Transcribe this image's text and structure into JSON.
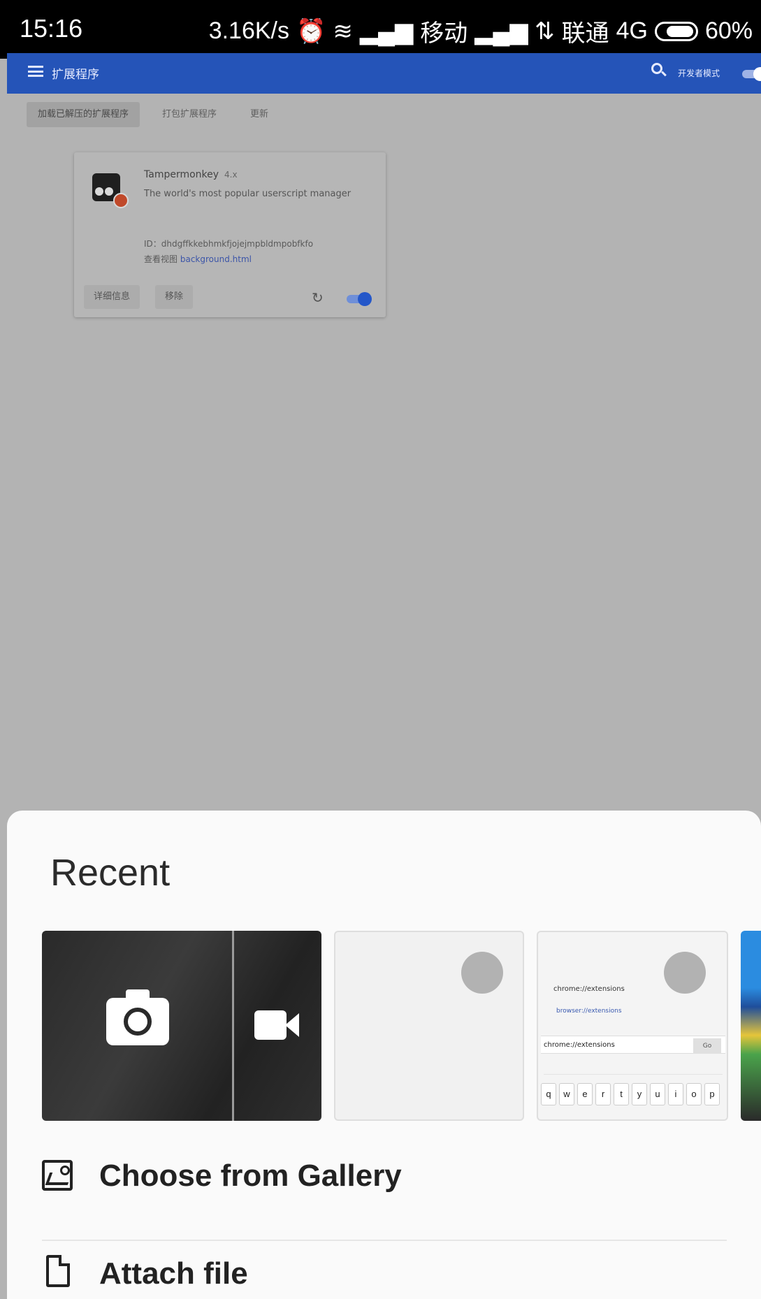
{
  "status_bar": {
    "time": "15:16",
    "speed": "3.16K/s",
    "carrier1": "移动",
    "carrier2": "联通",
    "network": "4G",
    "battery": "60%"
  },
  "header": {
    "title": "扩展程序",
    "dev_mode_label": "开发者模式"
  },
  "toolbar": {
    "load_unpacked": "加载已解压的扩展程序",
    "pack": "打包扩展程序",
    "update": "更新"
  },
  "extension": {
    "name": "Tampermonkey",
    "version": "4.x",
    "description": "The world's most popular userscript manager",
    "id": "ID：dhdgffkkebhmkfjojejmpbldmpobfkfo",
    "view_label": "查看视图",
    "view_link": "background.html",
    "details_label": "详细信息",
    "remove_label": "移除",
    "enabled": true
  },
  "sheet": {
    "title": "Recent",
    "choose_gallery": "Choose from Gallery",
    "attach_file": "Attach file",
    "screenshot": {
      "line1": "chrome://extensions",
      "line2": "browser://extensions",
      "url": "chrome://extensions",
      "go": "Go",
      "keys": [
        "q",
        "w",
        "e",
        "r",
        "t",
        "y",
        "u",
        "i",
        "o",
        "p"
      ]
    }
  }
}
